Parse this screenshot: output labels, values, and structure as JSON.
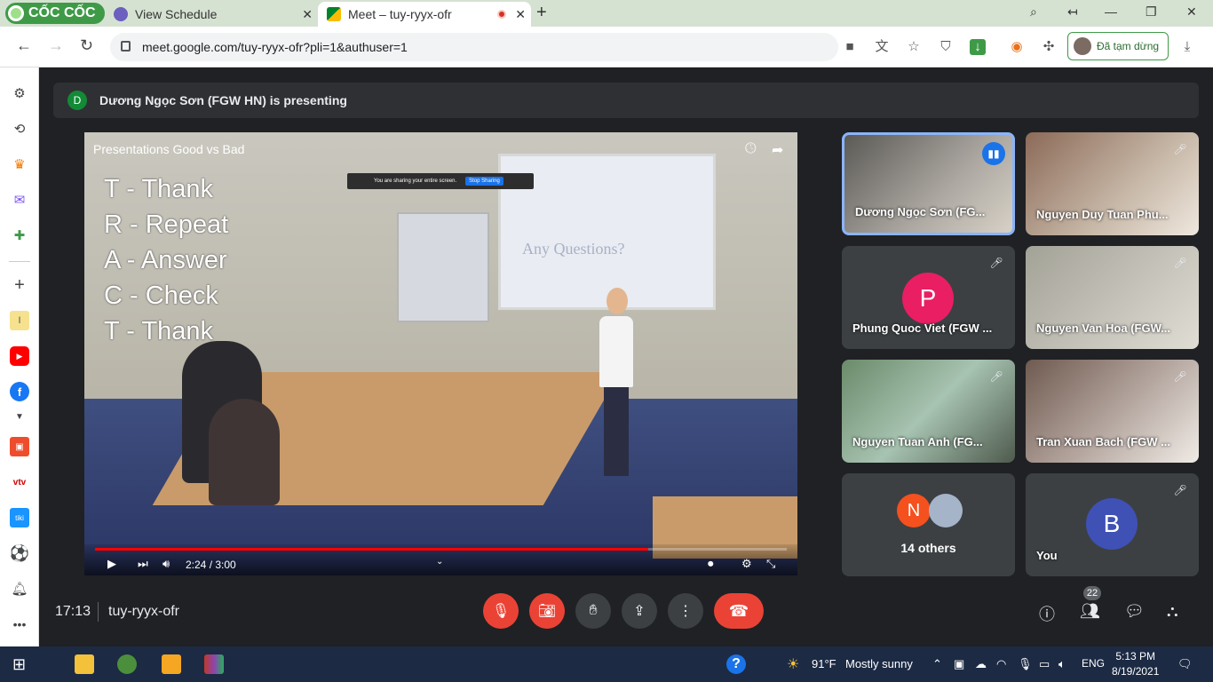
{
  "browser": {
    "brand": "CỐC CỐC",
    "tabs": [
      {
        "title": "View Schedule"
      },
      {
        "title": "Meet – tuy-ryyx-ofr"
      }
    ],
    "url": "meet.google.com/tuy-ryyx-ofr?pli=1&authuser=1",
    "profile_status": "Đã tạm dừng"
  },
  "presenting": {
    "avatar_letter": "D",
    "text": "Dương Ngọc Sơn (FGW HN) is presenting"
  },
  "video": {
    "title": "Presentations Good vs Bad",
    "acronym_lines": [
      "T - Thank",
      "R - Repeat",
      "A - Answer",
      "C - Check",
      "T - Thank"
    ],
    "screen_text": "Any Questions?",
    "share_notice": "You are sharing your entire screen.",
    "share_stop": "Stop Sharing",
    "time": "2:24 / 3:00",
    "progress": 0.8
  },
  "participants": [
    {
      "name": "Dương Ngọc Sơn (FG...",
      "speaking": true
    },
    {
      "name": "Nguyen Duy Tuan Phu...",
      "muted": true
    },
    {
      "name": "Phung Quoc Viet (FGW ...",
      "avatar_letter": "P",
      "avatar_color": "#e91e63",
      "muted": true
    },
    {
      "name": "Nguyen Van Hoa (FGW...",
      "muted": true
    },
    {
      "name": "Nguyen Tuan Anh (FG...",
      "muted": true
    },
    {
      "name": "Tran Xuan Bach (FGW ...",
      "muted": true
    }
  ],
  "others": {
    "label": "14 others",
    "avatar_letter": "N",
    "avatar_color": "#f4511e"
  },
  "self": {
    "name": "You",
    "avatar_letter": "B",
    "avatar_color": "#3f51b5"
  },
  "bottom": {
    "time": "17:13",
    "meeting_code": "tuy-ryyx-ofr",
    "participant_count": "22"
  },
  "taskbar": {
    "weather_temp": "91°F",
    "weather_desc": "Mostly sunny",
    "language": "ENG",
    "clock_time": "5:13 PM",
    "clock_date": "8/19/2021"
  }
}
